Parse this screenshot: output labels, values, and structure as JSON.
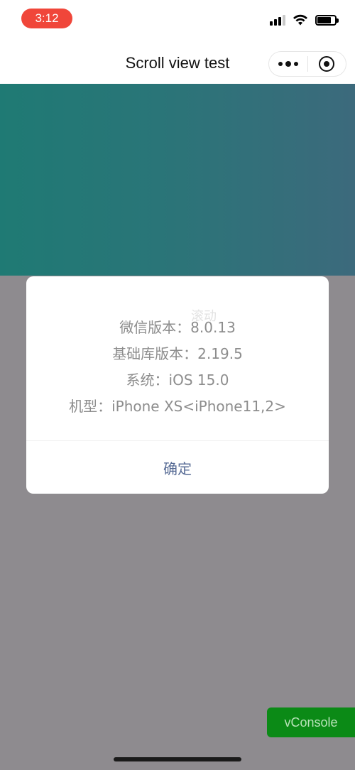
{
  "status_bar": {
    "time": "3:12",
    "icons": [
      "cellular-signal-icon",
      "wifi-icon",
      "battery-icon"
    ]
  },
  "nav": {
    "title": "Scroll view test",
    "capsule": {
      "more_icon": "more-dots-icon",
      "close_icon": "target-close-icon"
    }
  },
  "content": {
    "gradient_colors": [
      "#1f7a74",
      "#3c6a7c"
    ],
    "overlay_color": "#8e8b8f",
    "ghost_text": "滚动"
  },
  "modal": {
    "lines": [
      "微信版本：8.0.13",
      "基础库版本：2.19.5",
      "系统：iOS 15.0",
      "机型：iPhone XS<iPhone11,2>"
    ],
    "confirm_label": "确定",
    "confirm_color": "#576b95"
  },
  "vconsole": {
    "label": "vConsole",
    "color": "#0b8a16"
  }
}
